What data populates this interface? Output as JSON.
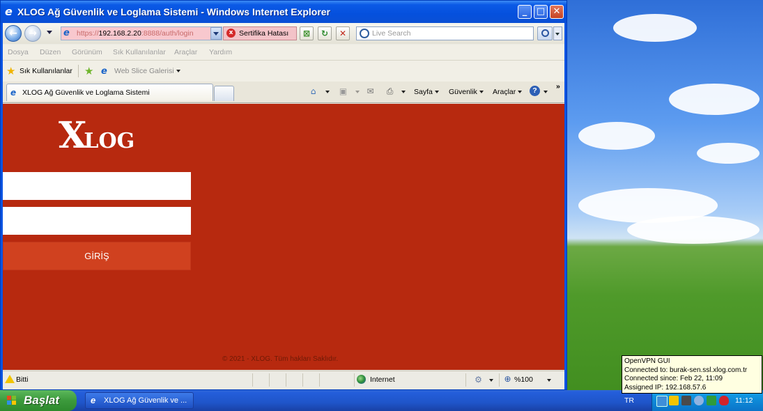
{
  "window": {
    "title": "XLOG Ağ Güvenlik ve Loglama Sistemi - Windows Internet Explorer",
    "minimize_glyph": "_",
    "maximize_glyph": "□",
    "close_glyph": "✕"
  },
  "address": {
    "scheme": "https://",
    "host": "192.168.2.20",
    "rest": ":8888/auth/login",
    "cert_error_label": "Sertifika Hatası"
  },
  "search": {
    "placeholder": "Live Search"
  },
  "menu": {
    "items": [
      "Dosya",
      "Düzen",
      "Görünüm",
      "Sık Kullanılanlar",
      "Araçlar",
      "Yardım"
    ]
  },
  "favorites": {
    "favorites_label": "Sık Kullanılanlar",
    "web_slice_label": "Web Slice Galerisi"
  },
  "tab": {
    "title": "XLOG Ağ Güvenlik ve Loglama Sistemi"
  },
  "commandbar": {
    "page_label": "Sayfa",
    "safety_label": "Güvenlik",
    "tools_label": "Araçlar",
    "help_glyph": "?",
    "chevron": "»"
  },
  "page": {
    "logo_x": "X",
    "logo_rest": "LOG",
    "username_value": "",
    "password_value": "",
    "login_button_label": "GİRİŞ",
    "copyright": "© 2021 - XLOG. Tüm hakları Saklıdır."
  },
  "statusbar": {
    "status_text": "Bitti",
    "zone_label": "Internet",
    "zoom_label": "%100"
  },
  "taskbar": {
    "start_label": "Başlat",
    "task_item_label": "XLOG Ağ Güvenlik ve ...",
    "language": "TR",
    "clock": "11:12"
  },
  "tooltip": {
    "title": "OpenVPN GUI",
    "connected_to": "Connected to: burak-sen.ssl.xlog.com.tr",
    "connected_since": "Connected since: Feb 22, 11:09",
    "assigned_ip": "Assigned IP: 192.168.57.6"
  },
  "colors": {
    "page_background": "#b7290f",
    "login_button": "#d0411f",
    "titlebar": "#0550dd"
  }
}
